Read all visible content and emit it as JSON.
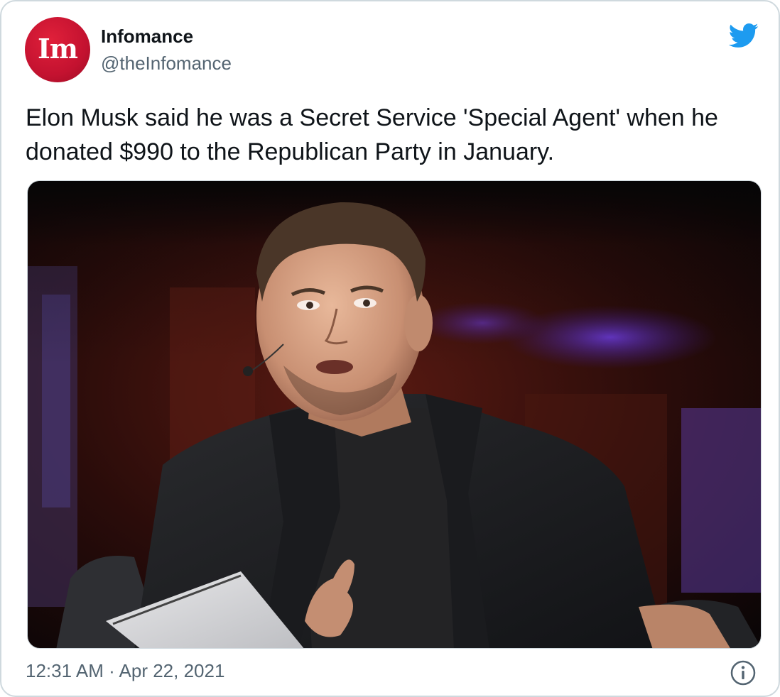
{
  "tweet": {
    "author": {
      "name": "Infomance",
      "handle": "@theInfomance",
      "avatar_text": "Im"
    },
    "text": "Elon Musk said he was a Secret Service 'Special Agent' when he donated $990 to the Republican Party in January.",
    "timestamp": "12:31 AM · Apr 22, 2021"
  },
  "icons": {
    "brand": "twitter-bird-icon",
    "info": "info-icon"
  },
  "colors": {
    "avatar_red": "#c41230",
    "twitter_blue": "#1d9bf0",
    "secondary_text": "#536471",
    "border": "#cfd9de"
  }
}
